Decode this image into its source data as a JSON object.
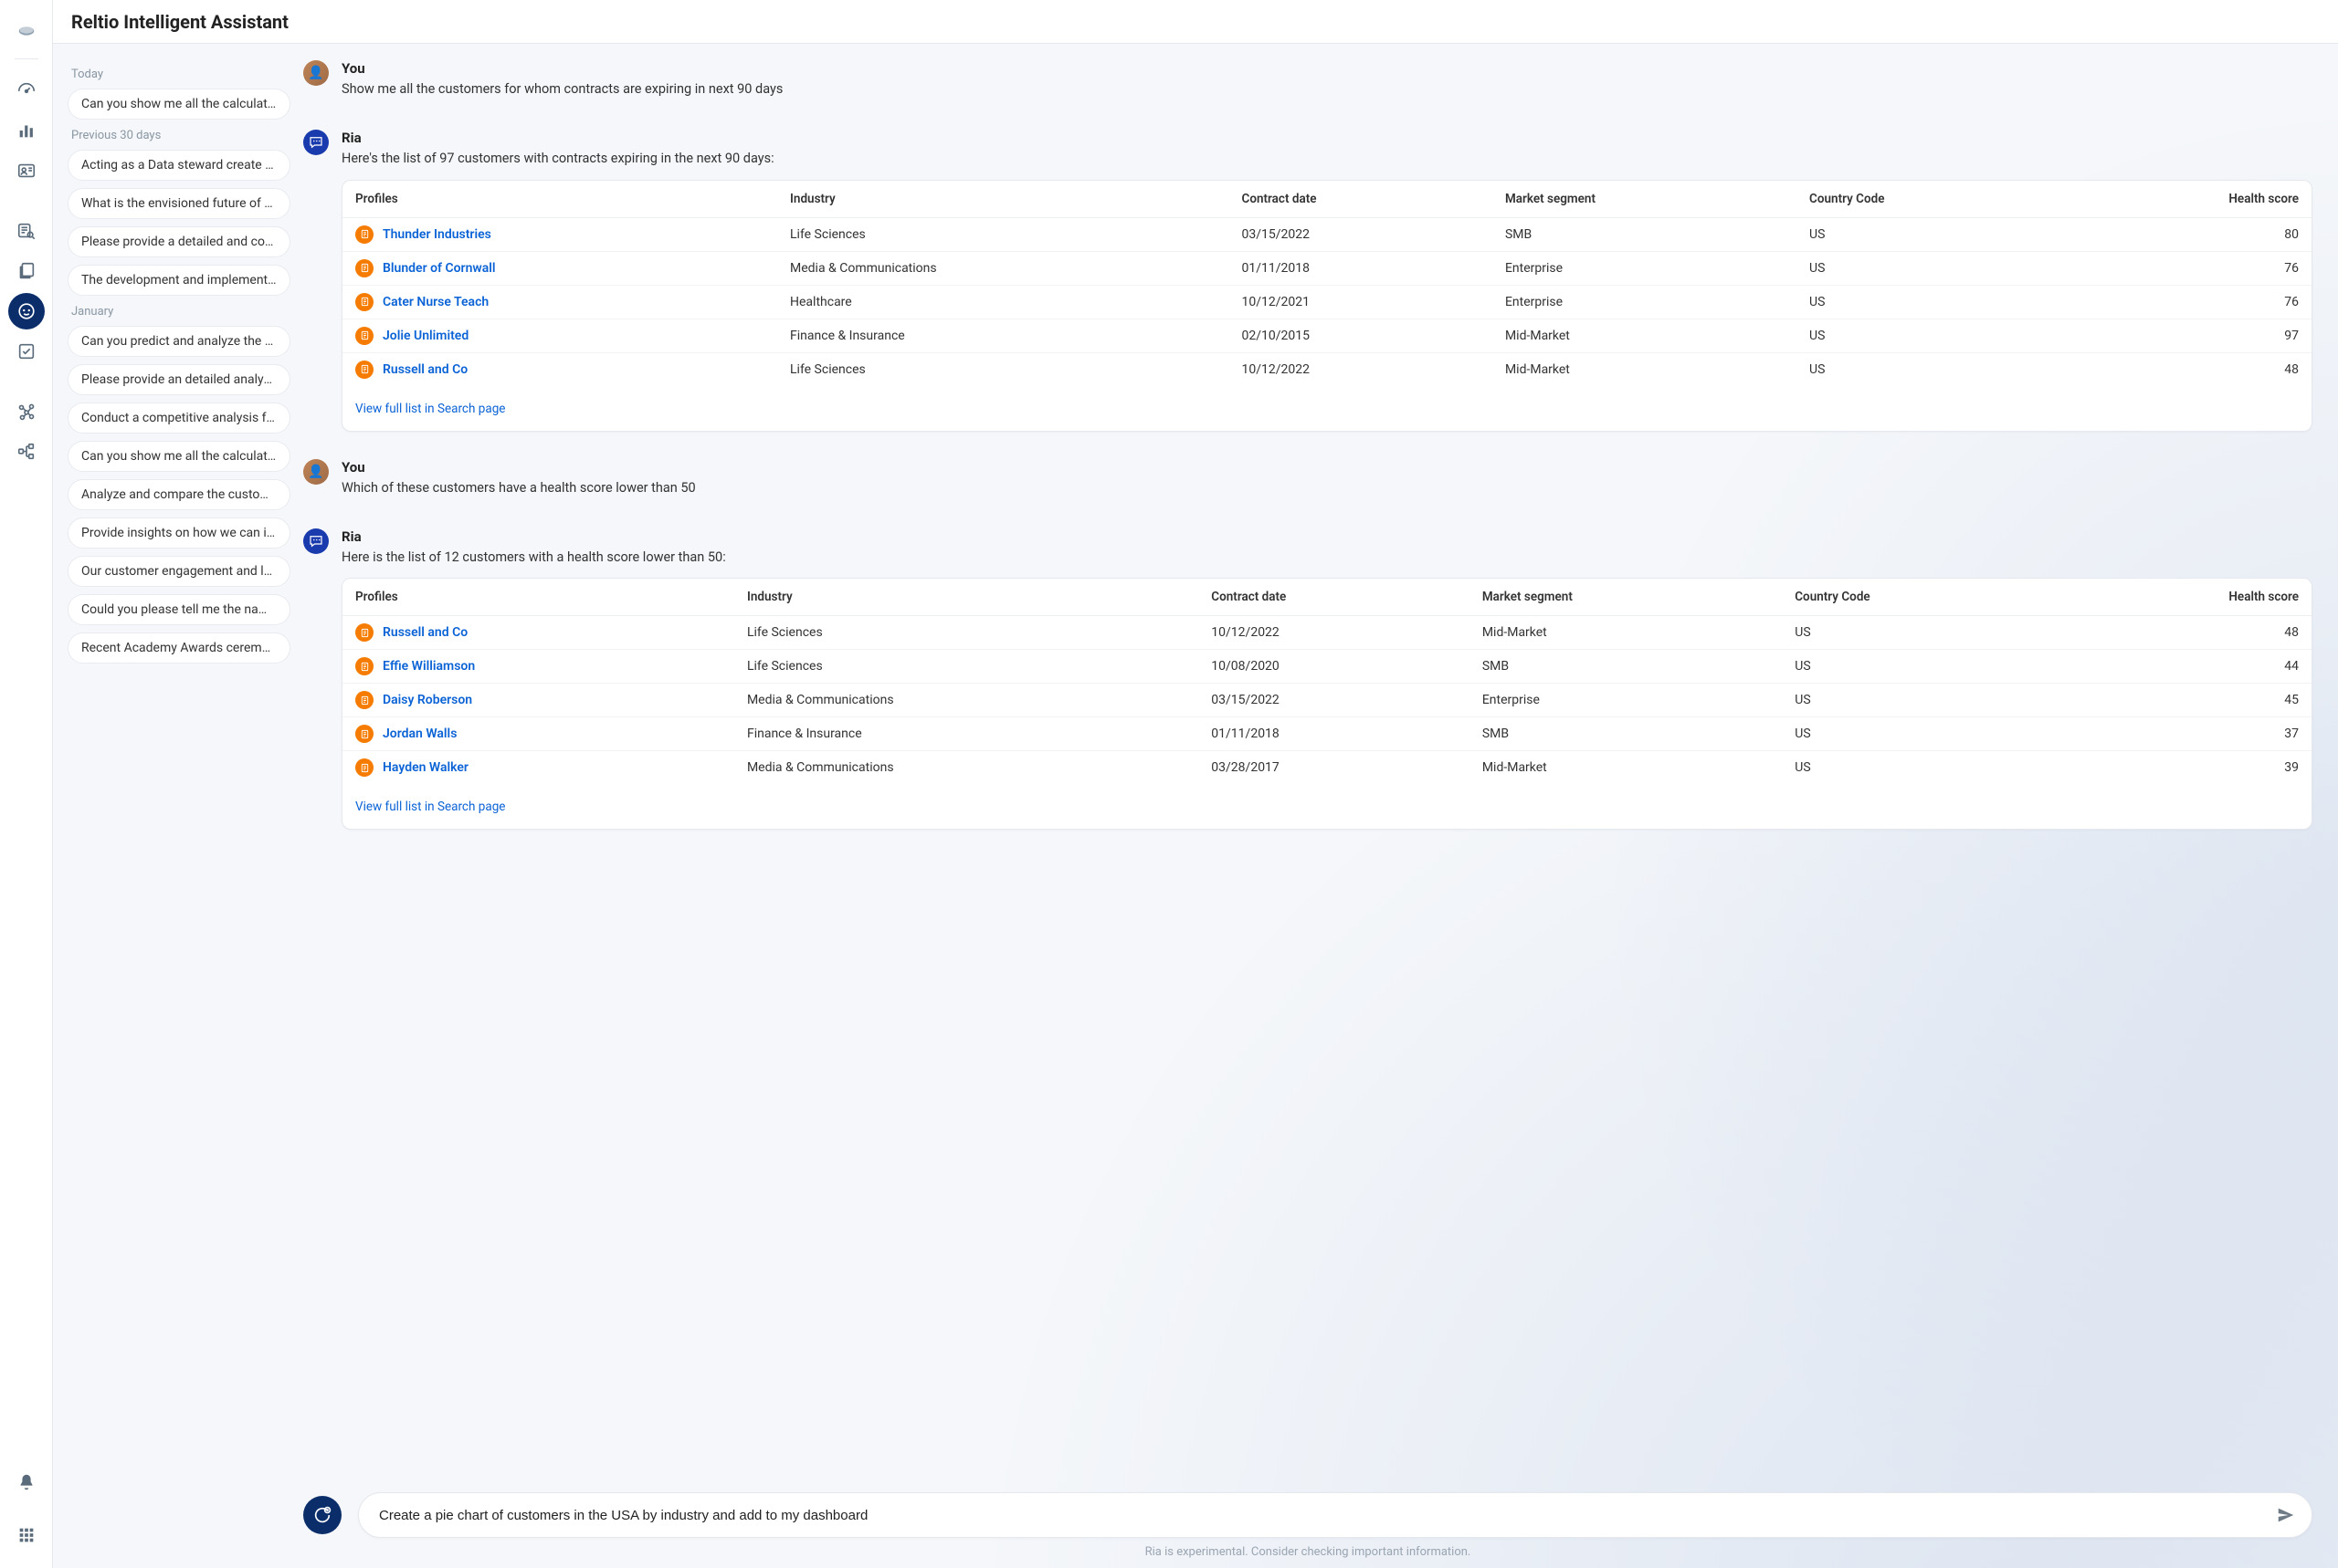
{
  "header": {
    "title": "Reltio Intelligent Assistant"
  },
  "history": {
    "groups": [
      {
        "label": "Today",
        "items": [
          "Can you show me all the calculated a…"
        ]
      },
      {
        "label": "Previous 30 days",
        "items": [
          "Acting as a Data steward create a An…",
          "What is the envisioned future of artifi…",
          "Please provide a detailed and compre…",
          "The development and implementation"
        ]
      },
      {
        "label": "January",
        "items": [
          "Can you predict and analyze the futur…",
          "Please provide an detailed analysis",
          "Conduct a competitive analysis focus…",
          "Can you show me all the calculated a…",
          "Analyze and compare the customer d…",
          "Provide insights on how we can impr…",
          "Our customer engagement and loyalt…",
          "Could you please tell me the name of…",
          "Recent Academy Awards ceremony, h…"
        ]
      }
    ]
  },
  "conversation": [
    {
      "role": "user",
      "name": "You",
      "text": "Show me all the customers for whom contracts are expiring in next 90 days"
    },
    {
      "role": "ria",
      "name": "Ria",
      "text": "Here's the list of 97 customers with contracts expiring in the next 90 days:",
      "table": {
        "headers": [
          "Profiles",
          "Industry",
          "Contract date",
          "Market segment",
          "Country Code",
          "Health score"
        ],
        "rows": [
          {
            "profile": "Thunder Industries",
            "industry": "Life Sciences",
            "date": "03/15/2022",
            "segment": "SMB",
            "country": "US",
            "score": "80"
          },
          {
            "profile": "Blunder of Cornwall",
            "industry": "Media & Communications",
            "date": "01/11/2018",
            "segment": "Enterprise",
            "country": "US",
            "score": "76"
          },
          {
            "profile": "Cater Nurse Teach",
            "industry": "Healthcare",
            "date": "10/12/2021",
            "segment": "Enterprise",
            "country": "US",
            "score": "76"
          },
          {
            "profile": "Jolie Unlimited",
            "industry": "Finance & Insurance",
            "date": "02/10/2015",
            "segment": "Mid-Market",
            "country": "US",
            "score": "97"
          },
          {
            "profile": "Russell and Co",
            "industry": "Life Sciences",
            "date": "10/12/2022",
            "segment": "Mid-Market",
            "country": "US",
            "score": "48"
          }
        ],
        "footer_link": "View full list in Search page"
      }
    },
    {
      "role": "user",
      "name": "You",
      "text": "Which of these customers have a health score lower than 50"
    },
    {
      "role": "ria",
      "name": "Ria",
      "text": "Here is the list of 12 customers with a health score lower than 50:",
      "table": {
        "headers": [
          "Profiles",
          "Industry",
          "Contract date",
          "Market segment",
          "Country Code",
          "Health score"
        ],
        "rows": [
          {
            "profile": "Russell and Co",
            "industry": "Life Sciences",
            "date": "10/12/2022",
            "segment": "Mid-Market",
            "country": "US",
            "score": "48"
          },
          {
            "profile": "Effie Williamson",
            "industry": "Life Sciences",
            "date": "10/08/2020",
            "segment": "SMB",
            "country": "US",
            "score": "44"
          },
          {
            "profile": "Daisy Roberson",
            "industry": "Media & Communications",
            "date": "03/15/2022",
            "segment": "Enterprise",
            "country": "US",
            "score": "45"
          },
          {
            "profile": "Jordan Walls",
            "industry": "Finance & Insurance",
            "date": "01/11/2018",
            "segment": "SMB",
            "country": "US",
            "score": "37"
          },
          {
            "profile": "Hayden Walker",
            "industry": "Media & Communications",
            "date": "03/28/2017",
            "segment": "Mid-Market",
            "country": "US",
            "score": "39"
          }
        ],
        "footer_link": "View full list in Search page"
      }
    }
  ],
  "composer": {
    "value": "Create a pie chart of customers in the USA by industry and add to my dashboard"
  },
  "disclaimer": "Ria is experimental. Consider checking important information."
}
